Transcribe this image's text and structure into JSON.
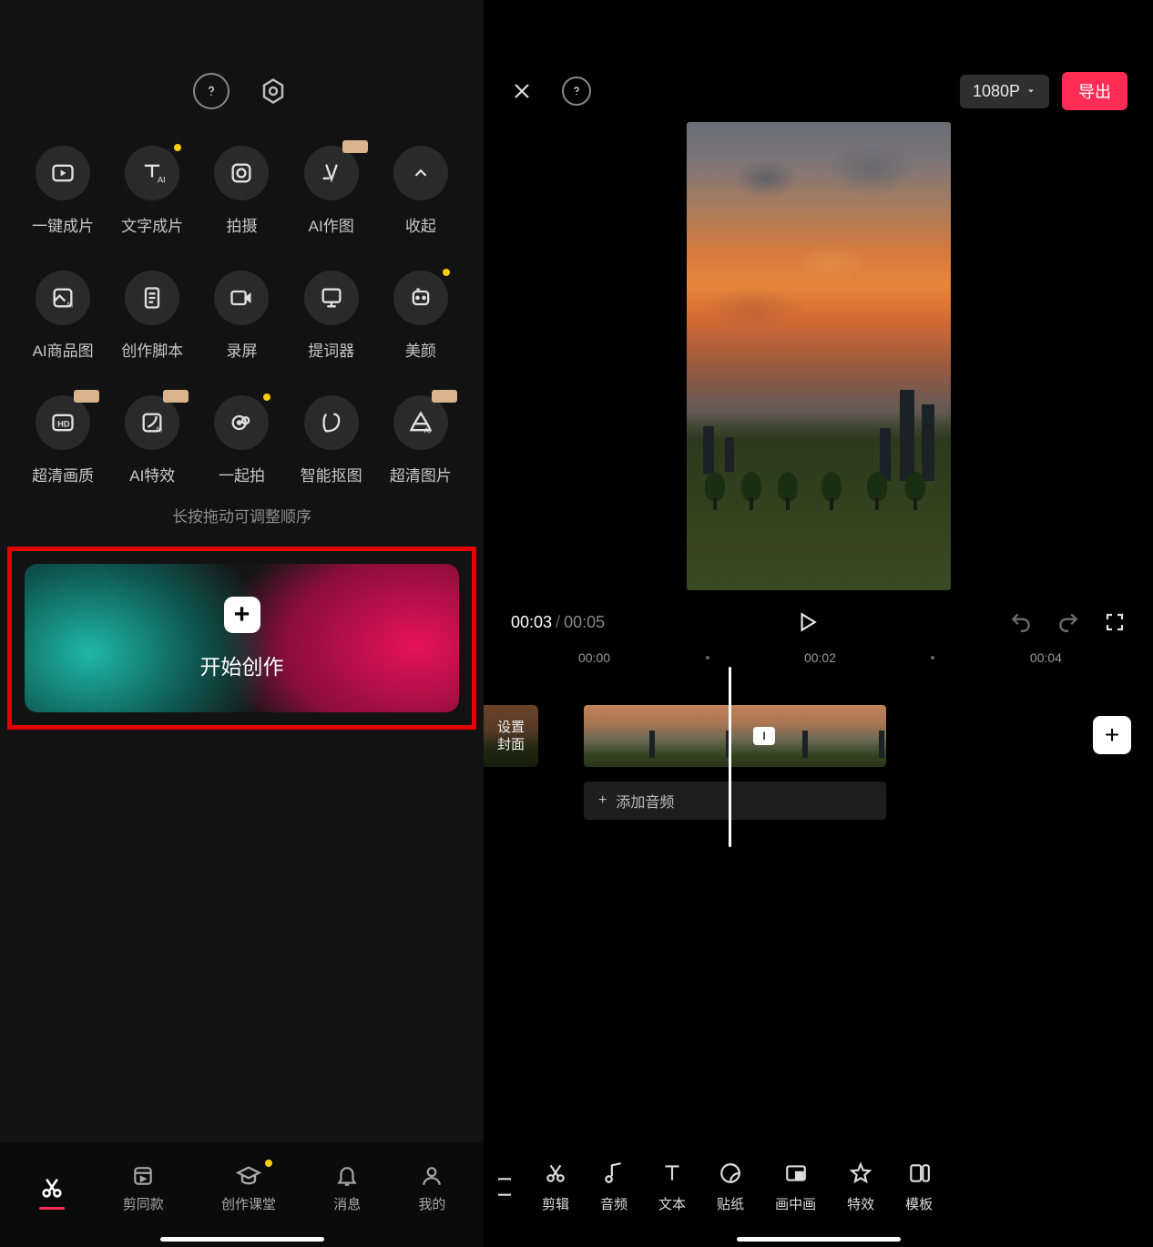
{
  "left": {
    "tools": [
      {
        "label": "一键成片",
        "decor": "none"
      },
      {
        "label": "文字成片",
        "decor": "dot"
      },
      {
        "label": "拍摄",
        "decor": "none"
      },
      {
        "label": "AI作图",
        "decor": "tan"
      },
      {
        "label": "收起",
        "decor": "none"
      },
      {
        "label": "AI商品图",
        "decor": "none"
      },
      {
        "label": "创作脚本",
        "decor": "none"
      },
      {
        "label": "录屏",
        "decor": "none"
      },
      {
        "label": "提词器",
        "decor": "none"
      },
      {
        "label": "美颜",
        "decor": "dot"
      },
      {
        "label": "超清画质",
        "decor": "tan"
      },
      {
        "label": "AI特效",
        "decor": "tan"
      },
      {
        "label": "一起拍",
        "decor": "dot"
      },
      {
        "label": "智能抠图",
        "decor": "none"
      },
      {
        "label": "超清图片",
        "decor": "tan"
      }
    ],
    "hint": "长按拖动可调整顺序",
    "start_label": "开始创作",
    "nav": [
      {
        "label": "剪辑",
        "active": true
      },
      {
        "label": "剪同款",
        "active": false
      },
      {
        "label": "创作课堂",
        "active": false,
        "dot": true
      },
      {
        "label": "消息",
        "active": false
      },
      {
        "label": "我的",
        "active": false
      }
    ]
  },
  "right": {
    "resolution": "1080P",
    "export_label": "导出",
    "time_current": "00:03",
    "time_sep": "/",
    "time_duration": "00:05",
    "ruler": {
      "t0": "00:00",
      "t1": "00:02",
      "t2": "00:04"
    },
    "set_cover_label": "设置\n封面",
    "add_audio_label": "添加音频",
    "nav": [
      {
        "label": "剪辑"
      },
      {
        "label": "音频"
      },
      {
        "label": "文本"
      },
      {
        "label": "贴纸"
      },
      {
        "label": "画中画"
      },
      {
        "label": "特效"
      },
      {
        "label": "模板"
      }
    ]
  }
}
